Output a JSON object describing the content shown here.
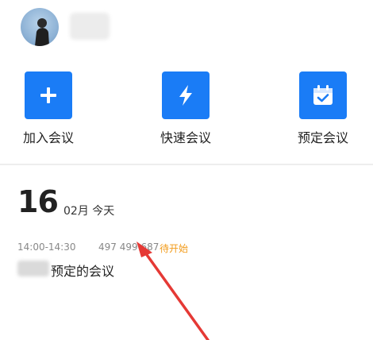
{
  "actions": [
    {
      "label": "加入会议",
      "icon": "plus-icon"
    },
    {
      "label": "快速会议",
      "icon": "lightning-icon"
    },
    {
      "label": "预定会议",
      "icon": "calendar-check-icon"
    }
  ],
  "date": {
    "day": "16",
    "month_label": "02月 今天"
  },
  "meeting": {
    "time_range": "14:00-14:30",
    "meeting_id": "497 499 687",
    "status": "待开始",
    "title_suffix": "预定的会议"
  },
  "colors": {
    "accent": "#1a7cf6",
    "status": "#f29b1a",
    "arrow": "#e53935"
  }
}
